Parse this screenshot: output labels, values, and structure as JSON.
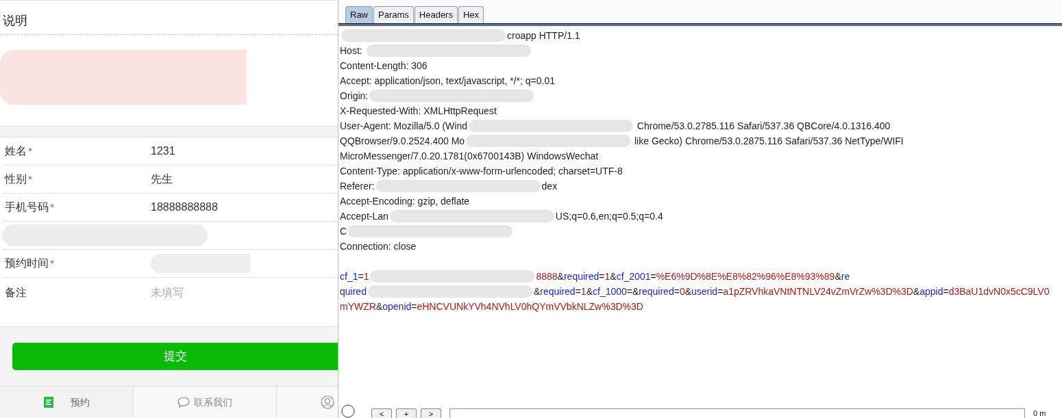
{
  "form_page": {
    "notice_title": "说明",
    "fields": [
      {
        "kind": "field",
        "label": "姓名",
        "required_mark": "*",
        "value": "1231"
      },
      {
        "kind": "field",
        "label": "性别",
        "required_mark": "*",
        "value": "先生"
      },
      {
        "kind": "field",
        "label": "手机号码",
        "required_mark": "*",
        "value": "18888888888"
      },
      {
        "kind": "redacted"
      },
      {
        "kind": "redacted_value",
        "label": "预约时间",
        "required_mark": "*"
      },
      {
        "kind": "field",
        "label": "备注",
        "placeholder": "未填写"
      }
    ],
    "submit_button": "提交",
    "nav": [
      {
        "label": "预约",
        "selected": true
      },
      {
        "label": "联系我们",
        "selected": false
      },
      {
        "selected": false
      }
    ]
  },
  "request_editor": {
    "tabs": [
      {
        "label": "Raw",
        "selected": true
      },
      {
        "label": "Params",
        "selected": false
      },
      {
        "label": "Headers",
        "selected": false
      },
      {
        "label": "Hex",
        "selected": false
      }
    ],
    "header_lines": [
      [
        {
          "kind": "redacted"
        },
        {
          "kind": "text",
          "text": "croapp HTTP/1.1"
        }
      ],
      [
        {
          "kind": "text",
          "text": "Host: "
        },
        {
          "kind": "redacted"
        }
      ],
      [
        {
          "kind": "text",
          "text": "Content-Length: 306"
        }
      ],
      [
        {
          "kind": "text",
          "text": "Accept: application/json, text/javascript, */*; q=0.01"
        }
      ],
      [
        {
          "kind": "text",
          "text": "Origin:"
        },
        {
          "kind": "redacted"
        }
      ],
      [
        {
          "kind": "text",
          "text": "X-Requested-With: XMLHttpRequest"
        }
      ],
      [
        {
          "kind": "text",
          "text": "User-Agent: Mozilla/5.0 (Wind"
        },
        {
          "kind": "redacted"
        },
        {
          "kind": "text",
          "text": " Chrome/53.0.2785.116 Safari/537.36 QBCore/4.0.1316.400"
        }
      ],
      [
        {
          "kind": "text",
          "text": "QQBrowser/9.0.2524.400 Mo"
        },
        {
          "kind": "redacted"
        },
        {
          "kind": "text",
          "text": " like Gecko) Chrome/53.0.2875.116 Safari/537.36 NetType/WIFI"
        }
      ],
      [
        {
          "kind": "text",
          "text": "MicroMessenger/7.0.20.1781(0x6700143B) WindowsWechat"
        }
      ],
      [
        {
          "kind": "text",
          "text": "Content-Type: application/x-www-form-urlencoded; charset=UTF-8"
        }
      ],
      [
        {
          "kind": "text",
          "text": "Referer:"
        },
        {
          "kind": "redacted"
        },
        {
          "kind": "text",
          "text": "dex"
        }
      ],
      [
        {
          "kind": "text",
          "text": "Accept-Encoding: gzip, deflate"
        }
      ],
      [
        {
          "kind": "text",
          "text": "Accept-Lan"
        },
        {
          "kind": "redacted"
        },
        {
          "kind": "text",
          "text": "US;q=0.6,en;q=0.5;q=0.4"
        }
      ],
      [
        {
          "kind": "text",
          "text": "C"
        },
        {
          "kind": "redacted"
        }
      ],
      [
        {
          "kind": "text",
          "text": "Connection: close"
        }
      ]
    ],
    "body_lines": [
      [
        {
          "kind": "key",
          "text": "cf_1"
        },
        {
          "kind": "sep",
          "text": "="
        },
        {
          "kind": "value",
          "text": "1"
        },
        {
          "kind": "redacted"
        },
        {
          "kind": "value",
          "text": "8888"
        },
        {
          "kind": "sep",
          "text": "&"
        },
        {
          "kind": "key",
          "text": "required"
        },
        {
          "kind": "sep",
          "text": "="
        },
        {
          "kind": "value",
          "text": "1"
        },
        {
          "kind": "sep",
          "text": "&"
        },
        {
          "kind": "key",
          "text": "cf_2001"
        },
        {
          "kind": "sep",
          "text": "="
        },
        {
          "kind": "value",
          "text": "%E6%9D%8E%E8%82%96%E8%93%89"
        },
        {
          "kind": "sep",
          "text": "&"
        },
        {
          "kind": "key",
          "text": "re"
        }
      ],
      [
        {
          "kind": "key",
          "text": "quired"
        },
        {
          "kind": "redacted"
        },
        {
          "kind": "sep",
          "text": "&"
        },
        {
          "kind": "key",
          "text": "required"
        },
        {
          "kind": "sep",
          "text": "="
        },
        {
          "kind": "value",
          "text": "1"
        },
        {
          "kind": "sep",
          "text": "&"
        },
        {
          "kind": "key",
          "text": "cf_1000"
        },
        {
          "kind": "sep",
          "text": "=&"
        },
        {
          "kind": "key",
          "text": "required"
        },
        {
          "kind": "sep",
          "text": "="
        },
        {
          "kind": "value",
          "text": "0"
        },
        {
          "kind": "sep",
          "text": "&"
        },
        {
          "kind": "key",
          "text": "userid"
        },
        {
          "kind": "sep",
          "text": "="
        },
        {
          "kind": "value",
          "text": "a1pZRVhkaVNtNTNLV24vZmVrZw%3D%3D"
        },
        {
          "kind": "sep",
          "text": "&"
        },
        {
          "kind": "key",
          "text": "appid"
        },
        {
          "kind": "sep",
          "text": "="
        },
        {
          "kind": "value",
          "text": "d3BaU1dvN0x5cC9LV0"
        }
      ],
      [
        {
          "kind": "value",
          "text": "mYWZR"
        },
        {
          "kind": "sep",
          "text": "&"
        },
        {
          "kind": "key",
          "text": "openid"
        },
        {
          "kind": "sep",
          "text": "="
        },
        {
          "kind": "value",
          "text": "eHNCVUNkYVh4NVhLV0hQYmVVbkNLZw%3D%3D"
        }
      ]
    ],
    "bottom_bar": {
      "buttons": [
        "<",
        "+",
        ">"
      ],
      "match_count": "0 m"
    }
  }
}
